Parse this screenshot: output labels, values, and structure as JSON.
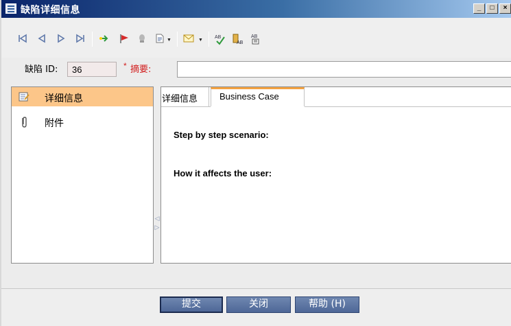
{
  "window": {
    "title": "缺陷详细信息",
    "controls": {
      "minimize": "_",
      "maximize": "□",
      "close": "×"
    }
  },
  "toolbar": {
    "icons": [
      "first-record-icon",
      "previous-record-icon",
      "next-record-icon",
      "last-record-icon",
      "follow-up-icon",
      "flag-icon",
      "highlight-icon",
      "document-icon",
      "mail-icon",
      "spell-check-icon",
      "thesaurus-icon",
      "spelling-options-icon"
    ]
  },
  "form": {
    "id_label": "缺陷 ID:",
    "id_value": "36",
    "required_marker": "*",
    "summary_label": "摘要:",
    "summary_value": ""
  },
  "sidebar": {
    "items": [
      {
        "label": "详细信息",
        "icon": "details-icon",
        "active": true
      },
      {
        "label": "附件",
        "icon": "attachment-icon",
        "active": false
      }
    ]
  },
  "tabs": [
    {
      "label": "详细信息",
      "active": false
    },
    {
      "label": "Business Case",
      "active": true
    }
  ],
  "content": {
    "fields": [
      "Step by step scenario:",
      "How it affects the user:"
    ]
  },
  "buttons": {
    "submit": "提交",
    "close": "关闭",
    "help": "帮助 (H)"
  },
  "colors": {
    "active_item": "#fcc689",
    "active_tab_accent": "#f4a342",
    "required_red": "#d21e1e",
    "button_blue": "#56709f"
  }
}
